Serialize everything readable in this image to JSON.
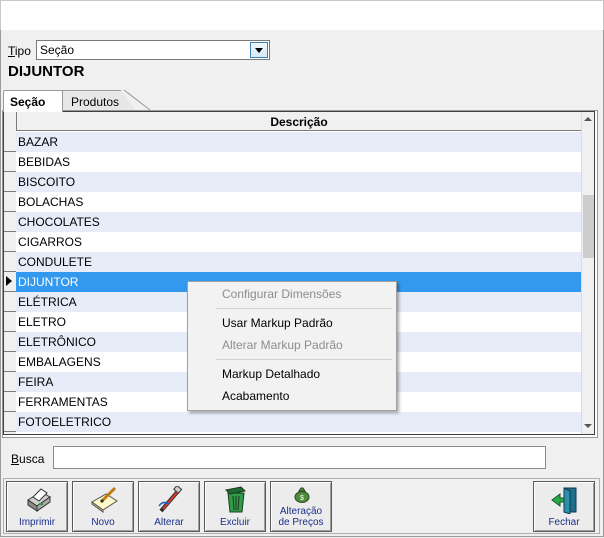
{
  "filter": {
    "tipo_label_underlined": "T",
    "tipo_label_rest": "ipo",
    "tipo_value": "Seção"
  },
  "heading": "DIJUNTOR",
  "tabs": [
    {
      "label": "Seção",
      "active": true
    },
    {
      "label": "Produtos",
      "active": false
    }
  ],
  "grid": {
    "column_header": "Descrição",
    "rows": [
      "BAZAR",
      "BEBIDAS",
      "BISCOITO",
      "BOLACHAS",
      "CHOCOLATES",
      "CIGARROS",
      "CONDULETE",
      "DIJUNTOR",
      "ELÉTRICA",
      "ELETRO",
      "ELETRÔNICO",
      "EMBALAGENS",
      "FEIRA",
      "FERRAMENTAS",
      "FOTOELETRICO"
    ],
    "selected_row": "DIJUNTOR",
    "selection_color": "#3399ee",
    "alt_row_color": "#e6edf8"
  },
  "context_menu": {
    "items": [
      {
        "label": "Configurar Dimensões",
        "enabled": false
      },
      {
        "label": "Usar Markup Padrão",
        "enabled": true
      },
      {
        "label": "Alterar Markup Padrão",
        "enabled": false
      },
      {
        "label": "Markup Detalhado",
        "enabled": true
      },
      {
        "label": "Acabamento",
        "enabled": true
      }
    ]
  },
  "search": {
    "label_underlined": "B",
    "label_rest": "usca",
    "value": ""
  },
  "toolbar": {
    "imprimir": "Imprimir",
    "novo": "Novo",
    "alterar": "Alterar",
    "excluir": "Excluir",
    "alteracao_line1": "Alteração",
    "alteracao_line2": "de Preços",
    "fechar": "Fechar"
  }
}
